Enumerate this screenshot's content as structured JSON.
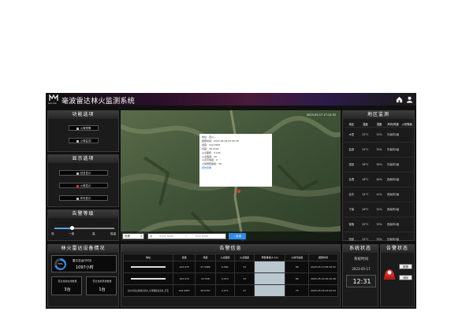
{
  "header": {
    "title": "毫波雷达林火监测系统",
    "logo_text": "Gondia"
  },
  "icons": {
    "home": "home-icon",
    "user": "user-icon"
  },
  "func_panel": {
    "title": "功能选项",
    "buttons": [
      "火情预警",
      "火情监测"
    ]
  },
  "display_panel": {
    "title": "显示选项",
    "buttons": [
      "回放显示",
      "火情显示",
      "风场显示"
    ]
  },
  "alarm_level": {
    "title": "告警等级",
    "ticks": [
      "低",
      "一般",
      "高",
      "极高"
    ],
    "level": 0.3
  },
  "map": {
    "timestamp": "2023-05-17 17:12:33",
    "popup_lines": [
      "地址：四川...",
      "报警时间：2023-05-06 03:50:36",
      "经度：102.3645",
      "纬度：26.1532",
      "火点面积：3.100",
      "火点强度：33",
      "火点可信度：0",
      "火情预警等级：36"
    ],
    "popup_link": "报告查看",
    "search": {
      "select": "查看",
      "start_placeholder": "Start Date",
      "end_placeholder": "End Date",
      "button": "查询"
    }
  },
  "region_panel": {
    "title": "地区监测",
    "headers": [
      "地区",
      "温度",
      "湿度",
      "风向/风速",
      "火情等级"
    ],
    "rows": [
      [
        "木里",
        "22°C",
        "31%",
        "东南风2级",
        ""
      ],
      [
        "盐源",
        "25°C",
        "33%",
        "东南风2级",
        ""
      ],
      [
        "德昌",
        "26°C",
        "30%",
        "东南风2级",
        ""
      ],
      [
        "会理",
        "28°C",
        "40%",
        "西南风2级",
        ""
      ],
      [
        "会东",
        "24°C",
        "41%",
        "西南风2级",
        ""
      ],
      [
        "宁南",
        "26°C",
        "31%",
        "西南风2级",
        ""
      ],
      [
        "普格",
        "25°C",
        "33%",
        "西南风2级",
        ""
      ],
      [
        "西昌",
        "25°C",
        "33%",
        "东南风2级",
        ""
      ]
    ]
  },
  "radar_panel": {
    "title": "林火雷达设备情况",
    "gauge_percent": "70%",
    "runtime_label": "雷达总运行时长",
    "runtime_value": "1097小时",
    "online_label": "雷达当前在线数量",
    "online_value": "3台",
    "offline_label": "雷达当前离线数量",
    "offline_value": "1台"
  },
  "alarm_panel": {
    "title": "告警信息",
    "headers": [
      "地址",
      "经度",
      "纬度",
      "火点面积",
      "火点强度",
      "预警等级(1-10)",
      "火情可信度",
      "报警时间"
    ],
    "rows": [
      [
        "",
        "102.975",
        "27.5986",
        "0.081",
        "13",
        "",
        "80",
        "2023-05-13 08:36:32"
      ],
      [
        "",
        "102.972",
        "27.536",
        "0.072",
        "13",
        "",
        "80",
        "2023-05-10 00:40:46"
      ],
      [
        "四川省凉山彝族自治州_木里藏族自治县_乔瓦",
        "102.9467",
        "28.0767",
        "0.071",
        "13",
        "",
        "75",
        "2023-05-06 04:00:00"
      ]
    ]
  },
  "status_panel": {
    "title": "系统状态",
    "time_label": "系统时间",
    "date": "2023-05-17",
    "time": "12:31"
  },
  "warning_panel": {
    "title": "告警状态",
    "btn1": "报警",
    "btn2": "消除"
  }
}
